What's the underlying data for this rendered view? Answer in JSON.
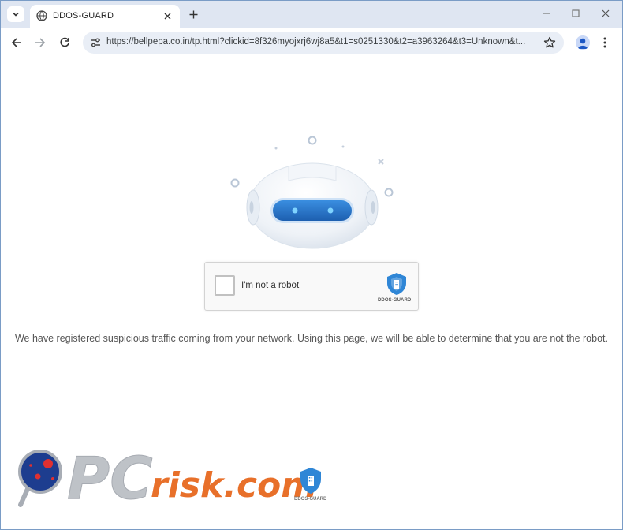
{
  "browser": {
    "tab_title": "DDOS-GUARD",
    "url": "https://bellpepa.co.in/tp.html?clickid=8f326myojxrj6wj8a5&t1=s0251330&t2=a3963264&t3=Unknown&t..."
  },
  "page": {
    "captcha_label": "I'm not a robot",
    "captcha_brand": "DDOS-GUARD",
    "message": "We have registered suspicious traffic coming from your network. Using this page, we will be able to determine that you are not the robot."
  },
  "watermark": {
    "brand": "PCrisk.com",
    "shield_text": "DDOS-GUARD"
  },
  "colors": {
    "accent_blue": "#2f86d6",
    "watermark_orange": "#e8702a"
  }
}
